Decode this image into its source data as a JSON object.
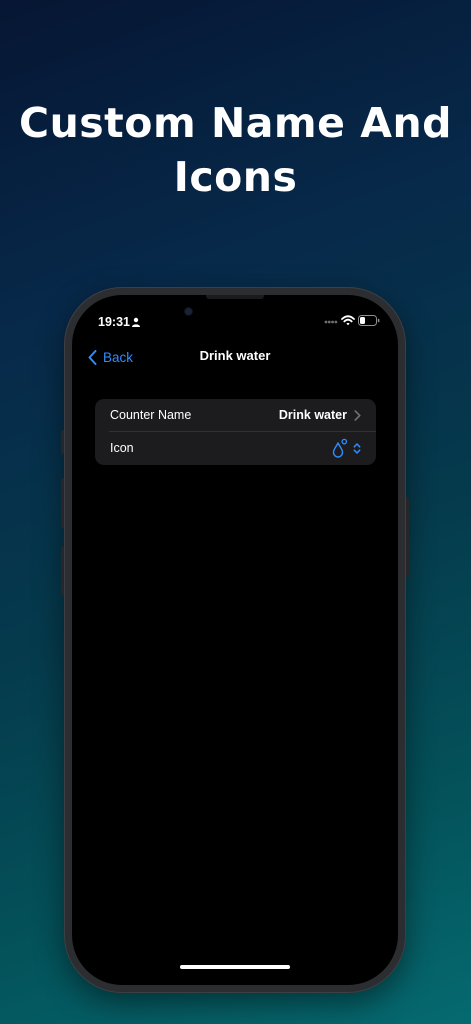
{
  "headline": {
    "line1": "Custom Name And",
    "line2": "Icons"
  },
  "status_bar": {
    "time": "19:31",
    "icons": [
      "person-icon",
      "dots-icon",
      "wifi-icon",
      "battery-icon"
    ]
  },
  "nav": {
    "back_label": "Back",
    "title": "Drink water"
  },
  "settings": {
    "rows": [
      {
        "label": "Counter Name",
        "value": "Drink water",
        "accessory": "chevron-right-icon"
      },
      {
        "label": "Icon",
        "value_icon": "water-drop-icon",
        "accessory": "chevron-up-down-icon"
      }
    ]
  },
  "colors": {
    "accent": "#2f8cff",
    "screen_bg": "#000000",
    "group_bg": "#1c1c1e",
    "background_top": "#061633",
    "background_bottom": "#056a70"
  }
}
